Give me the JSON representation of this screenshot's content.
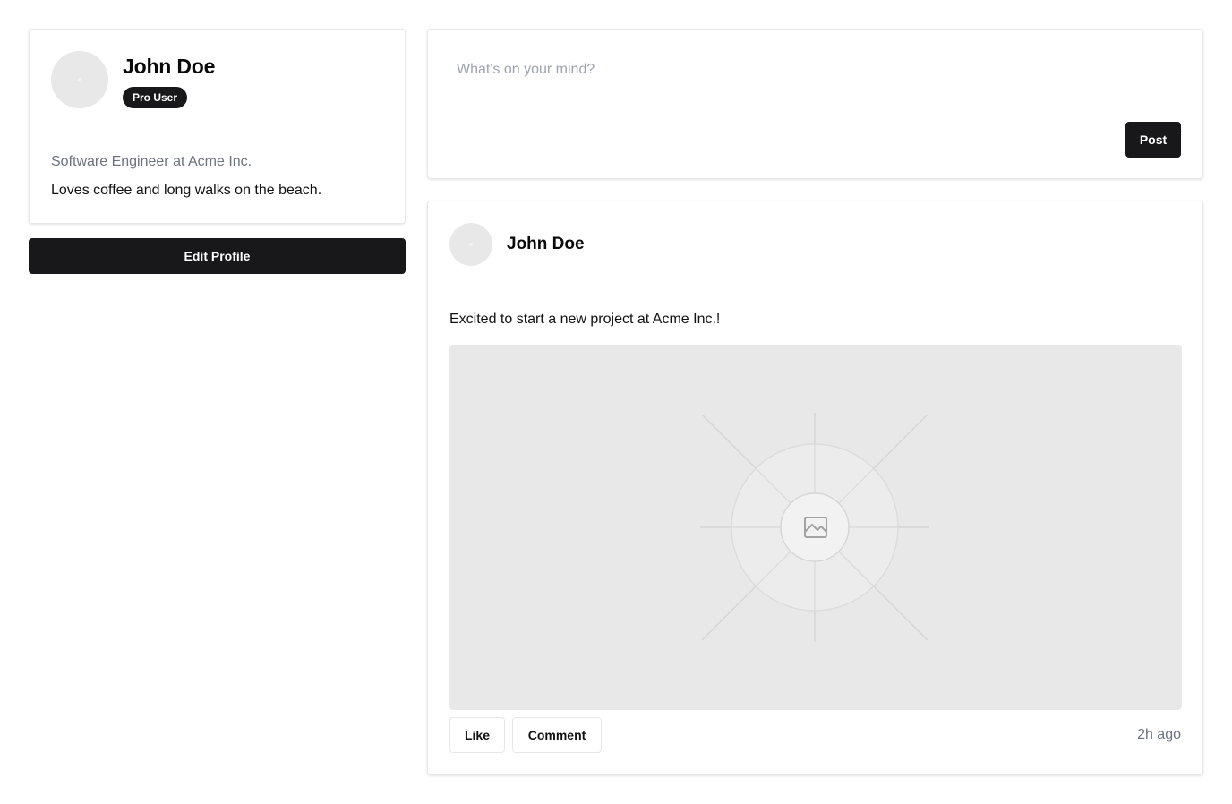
{
  "profile": {
    "name": "John Doe",
    "badge": "Pro User",
    "title": "Software Engineer at Acme Inc.",
    "bio": "Loves coffee and long walks on the beach.",
    "edit_label": "Edit Profile"
  },
  "composer": {
    "placeholder": "What's on your mind?",
    "value": "",
    "post_label": "Post"
  },
  "post": {
    "author": "John Doe",
    "text": "Excited to start a new project at Acme Inc.!",
    "image_icon": "image-placeholder-icon",
    "like_label": "Like",
    "comment_label": "Comment",
    "time": "2h ago"
  },
  "colors": {
    "primary": "#18181b",
    "muted_text": "#6b7280",
    "placeholder_bg": "#e8e8e8",
    "border": "#e5e7eb"
  }
}
